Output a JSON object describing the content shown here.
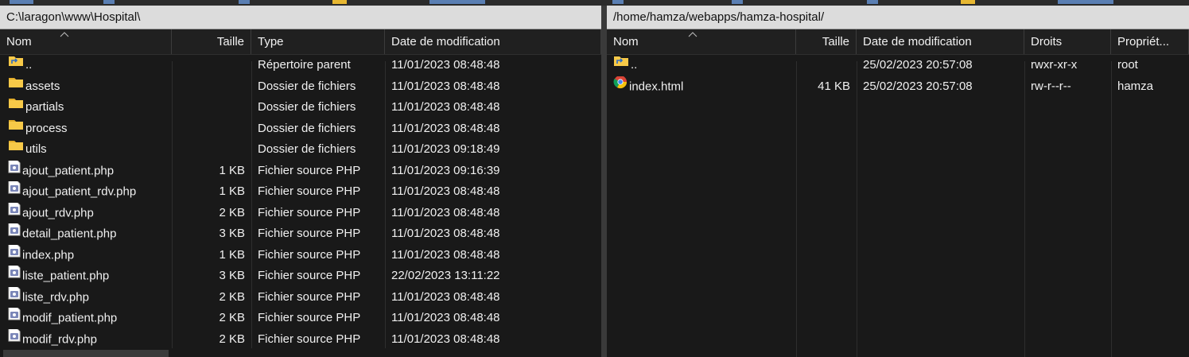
{
  "local": {
    "path": "C:\\laragon\\www\\Hospital\\",
    "columns": [
      "Nom",
      "Taille",
      "Type",
      "Date de modification"
    ],
    "rows": [
      {
        "name": "..",
        "size": "",
        "type": "Répertoire parent",
        "date": "11/01/2023  08:48:48",
        "icon": "parent-folder-icon"
      },
      {
        "name": "assets",
        "size": "",
        "type": "Dossier de fichiers",
        "date": "11/01/2023  08:48:48",
        "icon": "folder-icon"
      },
      {
        "name": "partials",
        "size": "",
        "type": "Dossier de fichiers",
        "date": "11/01/2023  08:48:48",
        "icon": "folder-icon"
      },
      {
        "name": "process",
        "size": "",
        "type": "Dossier de fichiers",
        "date": "11/01/2023  08:48:48",
        "icon": "folder-icon"
      },
      {
        "name": "utils",
        "size": "",
        "type": "Dossier de fichiers",
        "date": "11/01/2023  09:18:49",
        "icon": "folder-icon"
      },
      {
        "name": "ajout_patient.php",
        "size": "1 KB",
        "type": "Fichier source PHP",
        "date": "11/01/2023  09:16:39",
        "icon": "php-file-icon"
      },
      {
        "name": "ajout_patient_rdv.php",
        "size": "1 KB",
        "type": "Fichier source PHP",
        "date": "11/01/2023  08:48:48",
        "icon": "php-file-icon"
      },
      {
        "name": "ajout_rdv.php",
        "size": "2 KB",
        "type": "Fichier source PHP",
        "date": "11/01/2023  08:48:48",
        "icon": "php-file-icon"
      },
      {
        "name": "detail_patient.php",
        "size": "3 KB",
        "type": "Fichier source PHP",
        "date": "11/01/2023  08:48:48",
        "icon": "php-file-icon"
      },
      {
        "name": "index.php",
        "size": "1 KB",
        "type": "Fichier source PHP",
        "date": "11/01/2023  08:48:48",
        "icon": "php-file-icon"
      },
      {
        "name": "liste_patient.php",
        "size": "3 KB",
        "type": "Fichier source PHP",
        "date": "22/02/2023  13:11:22",
        "icon": "php-file-icon"
      },
      {
        "name": "liste_rdv.php",
        "size": "2 KB",
        "type": "Fichier source PHP",
        "date": "11/01/2023  08:48:48",
        "icon": "php-file-icon"
      },
      {
        "name": "modif_patient.php",
        "size": "2 KB",
        "type": "Fichier source PHP",
        "date": "11/01/2023  08:48:48",
        "icon": "php-file-icon"
      },
      {
        "name": "modif_rdv.php",
        "size": "2 KB",
        "type": "Fichier source PHP",
        "date": "11/01/2023  08:48:48",
        "icon": "php-file-icon"
      }
    ]
  },
  "remote": {
    "path": "/home/hamza/webapps/hamza-hospital/",
    "columns": [
      "Nom",
      "Taille",
      "Date de modification",
      "Droits",
      "Propriét..."
    ],
    "rows": [
      {
        "name": "..",
        "size": "",
        "date": "25/02/2023 20:57:08",
        "rights": "rwxr-xr-x",
        "owner": "root",
        "icon": "parent-folder-icon"
      },
      {
        "name": "index.html",
        "size": "41 KB",
        "date": "25/02/2023 20:57:08",
        "rights": "rw-r--r--",
        "owner": "hamza",
        "icon": "chrome-html-file-icon"
      }
    ]
  },
  "colors": {
    "panel_bg": "#191919",
    "path_bar_bg": "#dcdcdc",
    "folder": "#f7c948",
    "php_icon": "#7a86b8"
  }
}
